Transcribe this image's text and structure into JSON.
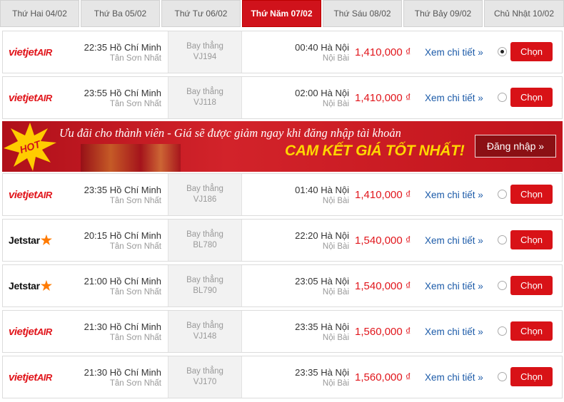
{
  "tabs": [
    {
      "label": "Thứ Hai 04/02"
    },
    {
      "label": "Thứ Ba 05/02"
    },
    {
      "label": "Thứ Tư 06/02"
    },
    {
      "label": "Thứ Năm 07/02"
    },
    {
      "label": "Thứ Sáu 08/02"
    },
    {
      "label": "Thứ Bảy 09/02"
    },
    {
      "label": "Chủ Nhật 10/02"
    }
  ],
  "active_tab": 3,
  "colors": {
    "accent": "#d0121b",
    "price": "#e1161c",
    "link": "#1b5aa8",
    "jetstar_star": "#ff7a00",
    "banner_highlight": "#ffd700"
  },
  "banner": {
    "hot_label": "HOT",
    "promo_text": "Ưu đãi cho thành viên - Giá sẽ được giảm ngay khi đăng nhập tài khoản",
    "guarantee_text": "CAM KẾT GIÁ TỐT NHẤT!",
    "login_label": "Đăng nhập »"
  },
  "airline_logos": {
    "vietjet": {
      "main": "vietjet",
      "suffix": "AIR"
    },
    "jetstar": {
      "main": "Jetstar",
      "icon": "star-icon"
    }
  },
  "flights": [
    {
      "airline": "vietjet",
      "dep_time_city": "22:35 Hồ Chí Minh",
      "dep_airport": "Tân Sơn Nhất",
      "type": "Bay thẳng",
      "code": "VJ194",
      "arr_time_city": "00:40 Hà Nội",
      "arr_airport": "Nội Bài",
      "price": "1,410,000 ₫",
      "detail": "Xem chi tiết »",
      "select": "Chọn",
      "selected": true
    },
    {
      "airline": "vietjet",
      "dep_time_city": "23:55 Hồ Chí Minh",
      "dep_airport": "Tân Sơn Nhất",
      "type": "Bay thẳng",
      "code": "VJ118",
      "arr_time_city": "02:00 Hà Nội",
      "arr_airport": "Nội Bài",
      "price": "1,410,000 ₫",
      "detail": "Xem chi tiết »",
      "select": "Chọn",
      "selected": false
    },
    {
      "airline": "vietjet",
      "dep_time_city": "23:35 Hồ Chí Minh",
      "dep_airport": "Tân Sơn Nhất",
      "type": "Bay thẳng",
      "code": "VJ186",
      "arr_time_city": "01:40 Hà Nội",
      "arr_airport": "Nội Bài",
      "price": "1,410,000 ₫",
      "detail": "Xem chi tiết »",
      "select": "Chọn",
      "selected": false
    },
    {
      "airline": "jetstar",
      "dep_time_city": "20:15 Hồ Chí Minh",
      "dep_airport": "Tân Sơn Nhất",
      "type": "Bay thẳng",
      "code": "BL780",
      "arr_time_city": "22:20 Hà Nội",
      "arr_airport": "Nội Bài",
      "price": "1,540,000 ₫",
      "detail": "Xem chi tiết »",
      "select": "Chọn",
      "selected": false
    },
    {
      "airline": "jetstar",
      "dep_time_city": "21:00 Hồ Chí Minh",
      "dep_airport": "Tân Sơn Nhất",
      "type": "Bay thẳng",
      "code": "BL790",
      "arr_time_city": "23:05 Hà Nội",
      "arr_airport": "Nội Bài",
      "price": "1,540,000 ₫",
      "detail": "Xem chi tiết »",
      "select": "Chọn",
      "selected": false
    },
    {
      "airline": "vietjet",
      "dep_time_city": "21:30 Hồ Chí Minh",
      "dep_airport": "Tân Sơn Nhất",
      "type": "Bay thẳng",
      "code": "VJ148",
      "arr_time_city": "23:35 Hà Nội",
      "arr_airport": "Nội Bài",
      "price": "1,560,000 ₫",
      "detail": "Xem chi tiết »",
      "select": "Chọn",
      "selected": false
    },
    {
      "airline": "vietjet",
      "dep_time_city": "21:30 Hồ Chí Minh",
      "dep_airport": "Tân Sơn Nhất",
      "type": "Bay thẳng",
      "code": "VJ170",
      "arr_time_city": "23:35 Hà Nội",
      "arr_airport": "Nội Bài",
      "price": "1,560,000 ₫",
      "detail": "Xem chi tiết »",
      "select": "Chọn",
      "selected": false
    }
  ]
}
